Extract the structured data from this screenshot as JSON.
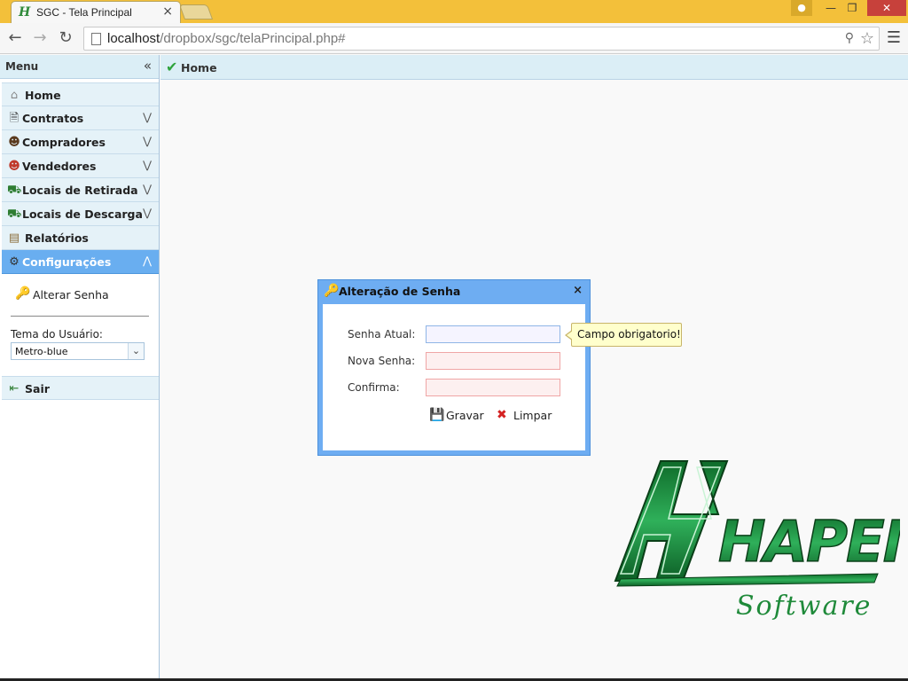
{
  "browser": {
    "tab_title": "SGC - Tela Principal",
    "tab_close": "×",
    "url_host": "localhost",
    "url_path": "/dropbox/sgc/telaPrincipal.php#"
  },
  "sidebar": {
    "title": "Menu",
    "items": [
      {
        "label": "Home",
        "icon": "home-icon"
      },
      {
        "label": "Contratos",
        "icon": "contract-icon"
      },
      {
        "label": "Compradores",
        "icon": "buyer-icon"
      },
      {
        "label": "Vendedores",
        "icon": "seller-icon"
      },
      {
        "label": "Locais de Retirada",
        "icon": "truck-icon"
      },
      {
        "label": "Locais de Descarga",
        "icon": "truck-icon"
      },
      {
        "label": "Relatórios",
        "icon": "report-icon"
      },
      {
        "label": "Configurações",
        "icon": "gear-icon"
      },
      {
        "label": "Sair",
        "icon": "exit-icon"
      }
    ],
    "config": {
      "alterar_senha": "Alterar Senha",
      "tema_label": "Tema do Usuário:",
      "tema_value": "Metro-blue"
    }
  },
  "main": {
    "title": "Home"
  },
  "dialog": {
    "title": "Alteração de Senha",
    "close": "×",
    "fields": [
      {
        "label": "Senha Atual:",
        "value": ""
      },
      {
        "label": "Nova Senha:",
        "value": ""
      },
      {
        "label": "Confirma:",
        "value": ""
      }
    ],
    "save_label": "Gravar",
    "clear_label": "Limpar",
    "tooltip": "Campo obrigatorio!"
  },
  "logo": {
    "name": "HAPEN",
    "tagline": "Software"
  },
  "colors": {
    "accent": "#69aef0",
    "header_bg": "#dbeef6",
    "logo_green": "#1f8a3a",
    "browser_frame": "#f3c03a"
  }
}
